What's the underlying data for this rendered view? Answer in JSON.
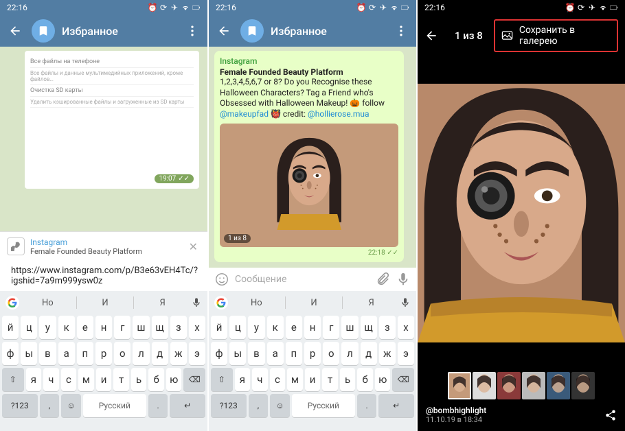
{
  "status": {
    "time": "22:16",
    "icons": [
      "alarm",
      "sync",
      "wifi",
      "signal",
      "airplane",
      "battery"
    ]
  },
  "screen1": {
    "header": {
      "title": "Избранное"
    },
    "preview": {
      "rows": [
        "Все файлы на телефоне",
        "Все файлы и данные мультимедийных приложений, кроме файлов…",
        "Очистка SD карты",
        "Удалить кэшированные файлы и загруженные из SD карты"
      ],
      "timestamp": "19:07"
    },
    "link_preview": {
      "source": "Instagram",
      "title": "Female Founded Beauty Platform"
    },
    "input": {
      "value": "https://www.instagram.com/p/B3e63vEH4Tc/?igshid=7a9m999ysw0z"
    },
    "keyboard": {
      "suggestions": [
        "Но",
        "И",
        "Я"
      ],
      "row1": [
        "й",
        "ц",
        "у",
        "к",
        "е",
        "н",
        "г",
        "ш",
        "щ",
        "з",
        "х"
      ],
      "row2": [
        "ф",
        "ы",
        "в",
        "а",
        "п",
        "р",
        "о",
        "л",
        "д",
        "ж",
        "э"
      ],
      "row3_shift": "⇧",
      "row3": [
        "я",
        "ч",
        "с",
        "м",
        "и",
        "т",
        "ь",
        "б",
        "ю"
      ],
      "row3_bksp": "⌫",
      "row4": {
        "sym": "?123",
        "comma": ",",
        "emoji": "☺",
        "space": "Русский",
        "dot": ".",
        "enter": "↵"
      }
    }
  },
  "screen2": {
    "header": {
      "title": "Избранное"
    },
    "message": {
      "source": "Instagram",
      "title": "Female Founded Beauty Platform",
      "text_before": "1,2,3,4,5,6,7 or 8? Do you Recognise these Halloween Characters? Tag a Friend who's Obsessed with Halloween Makeup! 🎃 follow ",
      "link1": "@makeupfad",
      "text_mid": " 👹 credit: ",
      "link2": "@hollierose.mua",
      "image_counter": "1 из 8",
      "timestamp": "22:18"
    },
    "input": {
      "placeholder": "Сообщение"
    }
  },
  "screen3": {
    "counter": "1 из 8",
    "save_button": "Сохранить в галерею",
    "footer": {
      "author": "@bombhighlight",
      "date": "11.10.19 в 18:34"
    },
    "thumbs_count": 6
  }
}
